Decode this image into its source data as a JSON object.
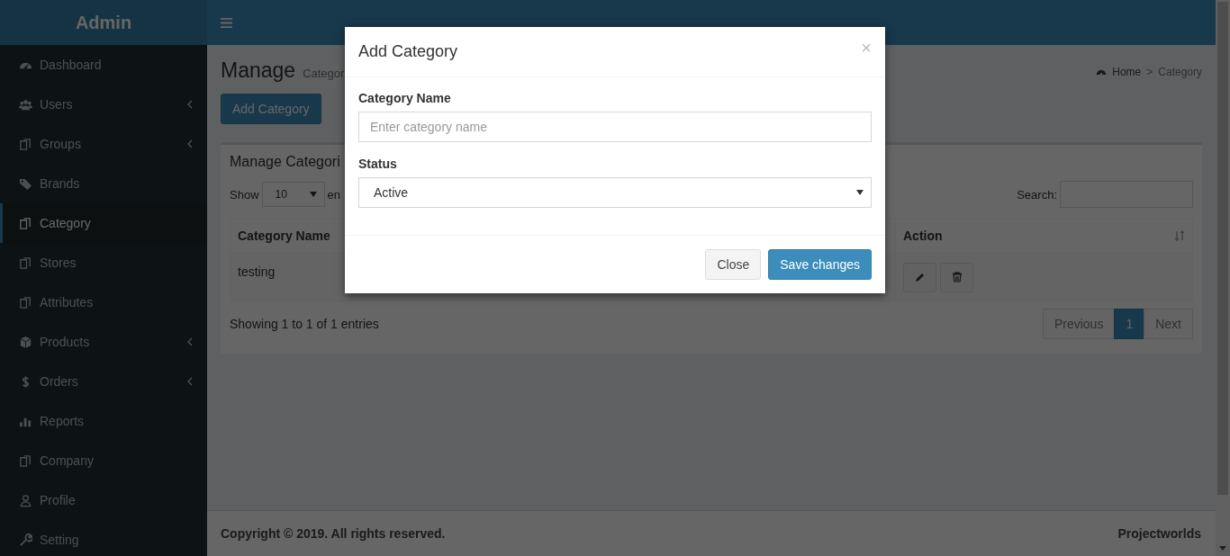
{
  "sidebar": {
    "brand": "Admin",
    "items": [
      {
        "label": "Dashboard",
        "selected": false,
        "expandable": false
      },
      {
        "label": "Users",
        "selected": false,
        "expandable": true
      },
      {
        "label": "Groups",
        "selected": false,
        "expandable": true
      },
      {
        "label": "Brands",
        "selected": false,
        "expandable": false
      },
      {
        "label": "Category",
        "selected": true,
        "expandable": false
      },
      {
        "label": "Stores",
        "selected": false,
        "expandable": false
      },
      {
        "label": "Attributes",
        "selected": false,
        "expandable": false
      },
      {
        "label": "Products",
        "selected": false,
        "expandable": true
      },
      {
        "label": "Orders",
        "selected": false,
        "expandable": true
      },
      {
        "label": "Reports",
        "selected": false,
        "expandable": false
      },
      {
        "label": "Company",
        "selected": false,
        "expandable": false
      },
      {
        "label": "Profile",
        "selected": false,
        "expandable": false
      },
      {
        "label": "Setting",
        "selected": false,
        "expandable": false
      }
    ]
  },
  "page": {
    "title": "Manage",
    "subtitle": "Categor",
    "breadcrumb": {
      "home": "Home",
      "separator": ">",
      "current": "Category"
    },
    "add_button": "Add Category"
  },
  "box": {
    "title": "Manage Categori",
    "show_label": "Show",
    "page_length": "10",
    "entries_label": "en",
    "search_label": "Search:",
    "columns": [
      {
        "label": "Category Name",
        "sortable": false
      },
      {
        "label": "Action",
        "sortable": true
      }
    ],
    "rows": [
      {
        "name": "testing"
      }
    ],
    "info": "Showing 1 to 1 of 1 entries",
    "pagination": [
      {
        "label": "Previous",
        "selected": false
      },
      {
        "label": "1",
        "selected": true
      },
      {
        "label": "Next",
        "selected": false
      }
    ]
  },
  "footer": {
    "copyright": "Copyright © 2019. All rights reserved.",
    "brand": "Projectworlds"
  },
  "modal": {
    "title": "Add Category",
    "close": "×",
    "fields": [
      {
        "label": "Category Name",
        "kind": "text",
        "placeholder": "Enter category name"
      },
      {
        "label": "Status",
        "kind": "select",
        "value": "Active"
      }
    ],
    "buttons": [
      {
        "label": "Close",
        "kind": "default"
      },
      {
        "label": "Save changes",
        "kind": "primary"
      }
    ]
  }
}
